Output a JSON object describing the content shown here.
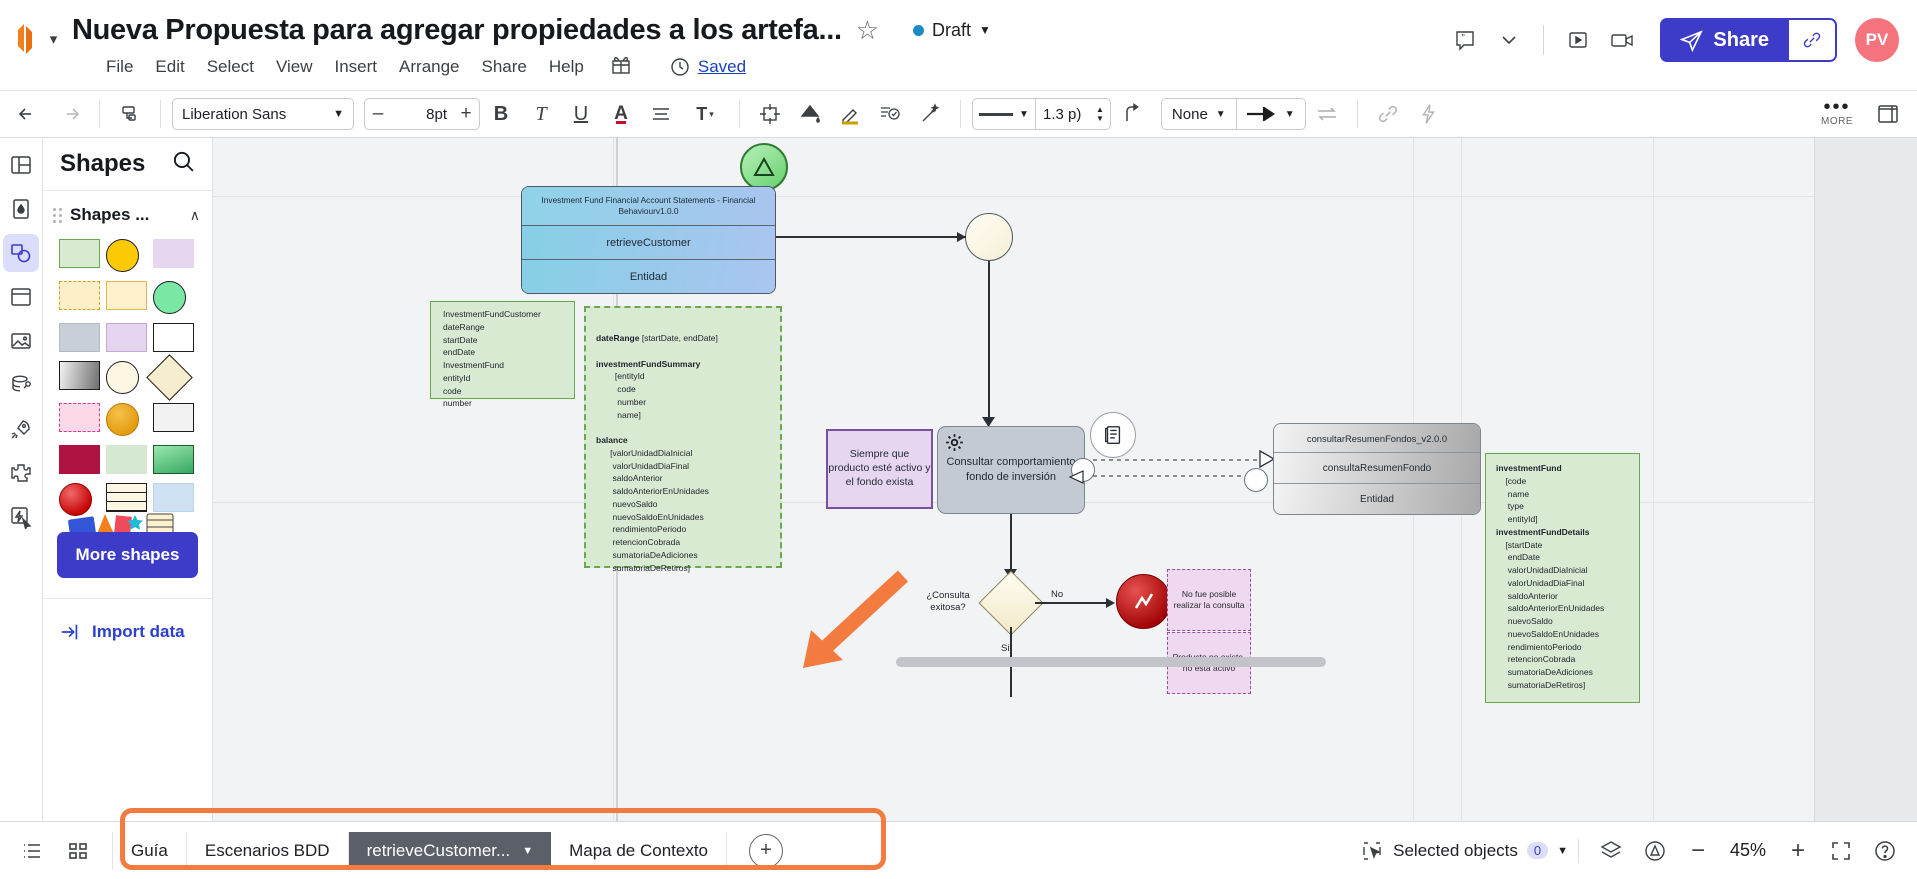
{
  "header": {
    "doc_title": "Nueva Propuesta para agregar propiedades a los artefa...",
    "star_icon": "star-outline-icon",
    "status": {
      "label": "Draft",
      "caret": "▼",
      "dot_color": "#1b8ac4"
    },
    "menu": [
      "File",
      "Edit",
      "Select",
      "View",
      "Insert",
      "Arrange",
      "Share",
      "Help"
    ],
    "gift_icon": "gift-icon",
    "saved": {
      "clock_icon": "clock-icon",
      "label": "Saved"
    },
    "right_icons": [
      "comment-icon",
      "chevron-down-icon",
      "present-icon",
      "video-icon"
    ],
    "share": {
      "label": "Share",
      "send_icon": "paper-plane-icon",
      "link_icon": "link-icon",
      "color": "#3c3cc8"
    },
    "avatar": {
      "initials": "PV",
      "color": "#f4737d"
    }
  },
  "toolbar": {
    "undo_icon": "undo-icon",
    "redo_icon": "redo-icon",
    "format_painter_icon": "format-painter-icon",
    "font_family": "Liberation Sans",
    "font_caret": "▼",
    "font_size": "8pt",
    "minus": "–",
    "plus": "+",
    "bold": "B",
    "italic": "T",
    "underline": "U",
    "text_color": "A",
    "align_icon": "align-icon",
    "text_options": "T",
    "distribute_icon": "distribute-icon",
    "fill_icon": "fill-bucket-icon",
    "line_color_icon": "line-color-icon",
    "note_icon": "note-check-icon",
    "magic_icon": "magic-wand-icon",
    "line_style_caret": "▼",
    "line_width": "1.3 p)",
    "connector_icon": "connector-elbow-icon",
    "endpoint_none": "None",
    "endpoint_caret": "▼",
    "arrow_icon": "arrow-right-icon",
    "arrow_caret": "▼",
    "swap_icon": "swap-ends-icon",
    "link_icon": "link-icon",
    "lightning_icon": "lightning-icon",
    "more_dots": "•••",
    "more_label": "MORE",
    "panel_icon": "right-panel-icon"
  },
  "rail": [
    {
      "name": "layout-icon",
      "active": false
    },
    {
      "name": "theme-icon",
      "active": false
    },
    {
      "name": "shapes-icon",
      "active": true
    },
    {
      "name": "frames-icon",
      "active": false
    },
    {
      "name": "image-icon",
      "active": false
    },
    {
      "name": "data-link-icon",
      "active": false
    },
    {
      "name": "templates-rocket-icon",
      "active": false
    },
    {
      "name": "integrations-puzzle-icon",
      "active": false
    },
    {
      "name": "actions-icon",
      "active": false
    }
  ],
  "panel": {
    "title": "Shapes",
    "search_icon": "search-icon",
    "section_title": "Shapes ...",
    "collapse_caret": "∧",
    "swatches": [
      {
        "shape": "rect",
        "fill": "#d9ead3",
        "stroke": "#6aa84f"
      },
      {
        "shape": "circle",
        "fill": "#fcc905",
        "stroke": "#1d1d1d"
      },
      {
        "shape": "rect",
        "fill": "#e6d6ef",
        "stroke": "#e6d6ef"
      },
      {
        "shape": "rect-dashed",
        "fill": "#fdf0c9",
        "stroke": "#d4a017"
      },
      {
        "shape": "rect",
        "fill": "#fdf0cd",
        "stroke": "#e0b84b"
      },
      {
        "shape": "circle",
        "fill": "#7ae8a4",
        "stroke": "#1d1d1d"
      },
      {
        "shape": "rect",
        "fill": "#c8cfd7",
        "stroke": "#b2bac3"
      },
      {
        "shape": "rect",
        "fill": "#e4d4ef",
        "stroke": "#c3aad4"
      },
      {
        "shape": "rect",
        "fill": "#ffffff",
        "stroke": "#1d1d1d"
      },
      {
        "shape": "rect-grad",
        "fill": "#8c8c8c",
        "stroke": "#1d1d1d"
      },
      {
        "shape": "circle",
        "fill": "#fdf6e3",
        "stroke": "#1d1d1d"
      },
      {
        "shape": "diamond",
        "fill": "#f5edcd",
        "stroke": "#1d1d1d"
      },
      {
        "shape": "rect-dashed",
        "fill": "#fcd9e8",
        "stroke": "#e0368c"
      },
      {
        "shape": "circle-grad",
        "fill": "#e39b10",
        "stroke": "#b87908"
      },
      {
        "shape": "rect",
        "fill": "#f2f2f2",
        "stroke": "#1d1d1d"
      },
      {
        "shape": "rect",
        "fill": "#ad1241",
        "stroke": "#ad1241"
      },
      {
        "shape": "rect",
        "fill": "#d5e8d2",
        "stroke": "#d5e8d2"
      },
      {
        "shape": "rect-grad-green",
        "fill": "#5fc97f",
        "stroke": "#1d5c2a"
      },
      {
        "shape": "circle-grad-red",
        "fill": "#e01b1b",
        "stroke": "#9d0000"
      },
      {
        "shape": "rect-lined",
        "fill": "#fdf6e3",
        "stroke": "#1d1d1d"
      },
      {
        "shape": "rect",
        "fill": "#cfe2f3",
        "stroke": "#b8d3ea"
      }
    ],
    "more_shapes": "More shapes",
    "import": {
      "icon": "import-arrow-icon",
      "label": "Import data"
    }
  },
  "canvas": {
    "retrieve_box": {
      "rows": [
        "Investment  Fund Financial Account Statements - Financial Behaviourv1.0.0",
        "retrieveCustomer",
        "Entidad"
      ]
    },
    "consultar_box": {
      "rows": [
        "consultarResumenFondos_v2.0.0",
        "consultaResumenFondo",
        "Entidad"
      ]
    },
    "note_left": "InvestmentFundCustomer\ndateRange\nstartDate\nendDate\nInvestmentFund\nentityId\ncode\nnumber",
    "note_dashed_lines": [
      {
        "bold": "dateRange",
        "rest": " [startDate, endDate]"
      },
      {
        "bold": "",
        "rest": ""
      },
      {
        "bold": "investmentFundSummary",
        "rest": ""
      },
      {
        "bold": "",
        "rest": "        [entityId"
      },
      {
        "bold": "",
        "rest": "         code"
      },
      {
        "bold": "",
        "rest": "         number"
      },
      {
        "bold": "",
        "rest": "         name]"
      },
      {
        "bold": "",
        "rest": ""
      },
      {
        "bold": "balance",
        "rest": ""
      },
      {
        "bold": "",
        "rest": "      [valorUnidadDiaInicial"
      },
      {
        "bold": "",
        "rest": "       valorUnidadDiaFinal"
      },
      {
        "bold": "",
        "rest": "       saldoAnterior"
      },
      {
        "bold": "",
        "rest": "       saldoAnteriorEnUnidades"
      },
      {
        "bold": "",
        "rest": "       nuevoSaldo"
      },
      {
        "bold": "",
        "rest": "       nuevoSaldoEnUnidades"
      },
      {
        "bold": "",
        "rest": "       rendimientoPeriodo"
      },
      {
        "bold": "",
        "rest": "       retencionCobrada"
      },
      {
        "bold": "",
        "rest": "       sumatoriaDeAdiciones"
      },
      {
        "bold": "",
        "rest": "       sumatoriaDeRetiros]"
      }
    ],
    "note_right_lines": [
      {
        "bold": "investmentFund",
        "rest": ""
      },
      {
        "bold": "",
        "rest": "    [code"
      },
      {
        "bold": "",
        "rest": "     name"
      },
      {
        "bold": "",
        "rest": "     type"
      },
      {
        "bold": "",
        "rest": "     entityId]"
      },
      {
        "bold": "investmentFundDetails",
        "rest": ""
      },
      {
        "bold": "",
        "rest": "    [startDate"
      },
      {
        "bold": "",
        "rest": "     endDate"
      },
      {
        "bold": "",
        "rest": "     valorUnidadDiaInicial"
      },
      {
        "bold": "",
        "rest": "     valorUnidadDiaFinal"
      },
      {
        "bold": "",
        "rest": "     saldoAnterior"
      },
      {
        "bold": "",
        "rest": "     saldoAnteriorEnUnidades"
      },
      {
        "bold": "",
        "rest": "     nuevoSaldo"
      },
      {
        "bold": "",
        "rest": "     nuevoSaldoEnUnidades"
      },
      {
        "bold": "",
        "rest": "     rendimientoPeriodo"
      },
      {
        "bold": "",
        "rest": "     retencionCobrada"
      },
      {
        "bold": "",
        "rest": "     sumatoriaDeAdiciones"
      },
      {
        "bold": "",
        "rest": "     sumatoriaDeRetiros]"
      }
    ],
    "purple_note": "Siempre que producto esté activo y el fondo exista",
    "task": {
      "label": "Consultar comportamiento fondo de inversión",
      "gear_icon": "gear-icon"
    },
    "doc_badge_icon": "document-icon",
    "gateway_label": "¿Consulta exitosa?",
    "branch_no": "No",
    "branch_si": "Si",
    "error_note_1": "No fue posible realizar la consulta",
    "error_note_2": "Producto no existe, no está activo",
    "start_event_icon": "start-event-icon",
    "green_event_icon": "green-triangle-event-icon",
    "red_event_icon": "red-error-event-icon"
  },
  "footer": {
    "list_icon": "list-view-icon",
    "grid_icon": "grid-view-icon",
    "tabs": [
      {
        "label": "Guía",
        "active": false
      },
      {
        "label": "Escenarios BDD",
        "active": false
      },
      {
        "label": "retrieveCustomer...",
        "active": true,
        "caret": "▼"
      },
      {
        "label": "Mapa de Contexto",
        "active": false
      }
    ],
    "add_tab": "+",
    "selection": {
      "icon": "select-cursor-icon",
      "label": "Selected objects",
      "count": "0",
      "caret": "▼"
    },
    "layers_icon": "layers-icon",
    "accessibility_icon": "accessibility-icon",
    "zoom_out": "−",
    "zoom_level": "45%",
    "zoom_in": "+",
    "fit_icon": "fit-screen-icon",
    "help_icon": "help-icon"
  }
}
